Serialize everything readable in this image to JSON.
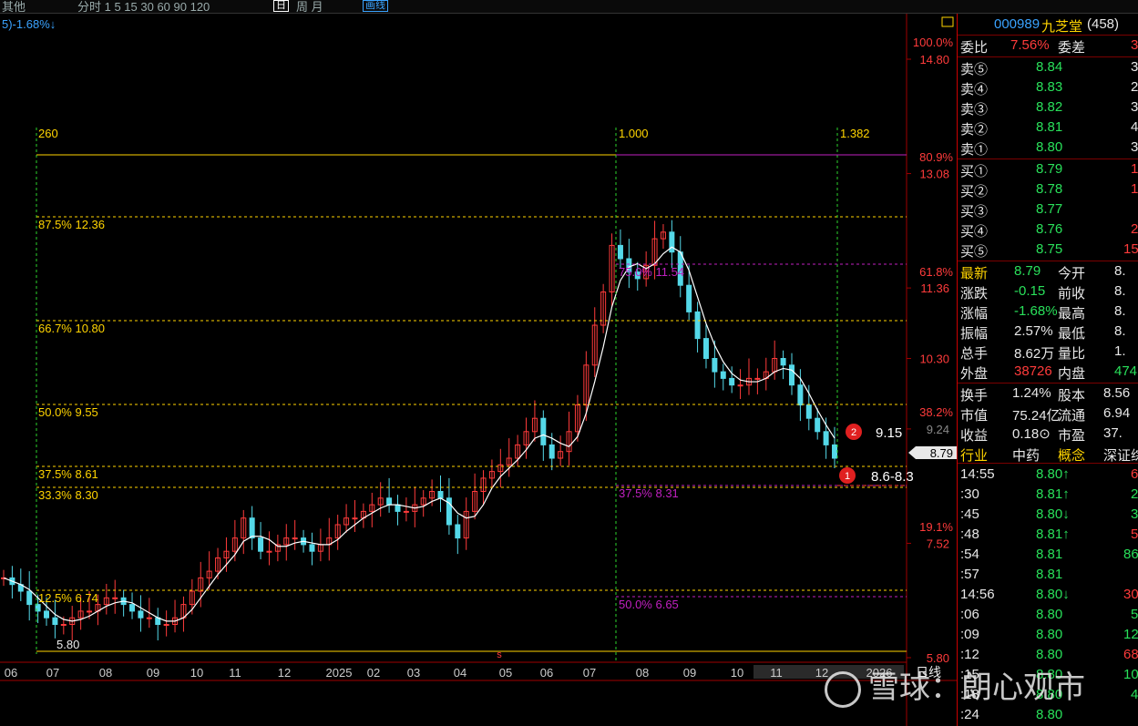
{
  "toolbar": {
    "left_text": "其他",
    "periods": "分时   1   5  15  30  60  90  120",
    "active_period": "日",
    "other_periods": "周  月",
    "button": "画线"
  },
  "chart_header": {
    "label": "5)-1.68%↓"
  },
  "chart_data": {
    "type": "candlestick",
    "title": "",
    "x_labels": [
      "06",
      "07",
      "08",
      "09",
      "10",
      "11",
      "12",
      "2025",
      "02",
      "03",
      "04",
      "05",
      "06",
      "07",
      "08",
      "09",
      "10",
      "11",
      "12",
      "2026"
    ],
    "y_ticks": [
      "14.80",
      "13.08",
      "11.36",
      "10.30",
      "9.24",
      "7.52",
      "5.80"
    ],
    "y_pct_ticks": [
      "100.0%",
      "80.9%",
      "61.8%",
      "38.2%",
      "19.1%"
    ],
    "ylim": [
      5.8,
      14.8
    ],
    "low_point": "5.80",
    "fib_left": {
      "start_label": "260",
      "levels": [
        {
          "label": "87.5% 12.36",
          "price": 12.36
        },
        {
          "label": "66.7% 10.80",
          "price": 10.8
        },
        {
          "label": "50.0% 9.55",
          "price": 9.55
        },
        {
          "label": "37.5% 8.61",
          "price": 8.61
        },
        {
          "label": "33.3% 8.30",
          "price": 8.3
        },
        {
          "label": "12.5% 6.74",
          "price": 6.74
        }
      ]
    },
    "fib_right": {
      "start_label": "1.000",
      "end_label": "1.382",
      "levels": [
        {
          "label": "75.0% 11.54",
          "price": 11.54
        },
        {
          "label": "37.5% 8.31",
          "price": 8.31
        },
        {
          "label": "50.0% 6.65",
          "price": 6.65
        }
      ]
    },
    "annotations": [
      {
        "num": "2",
        "text": "9.15",
        "price": 9.15
      },
      {
        "num": "1",
        "text": "8.6-8.3",
        "price": 8.45
      }
    ],
    "current_price": "8.79",
    "close_series": [
      7.0,
      6.9,
      6.8,
      6.6,
      6.5,
      6.4,
      6.3,
      6.3,
      6.4,
      6.5,
      6.5,
      6.6,
      6.7,
      6.7,
      6.6,
      6.5,
      6.4,
      6.4,
      6.3,
      6.3,
      6.4,
      6.6,
      6.8,
      7.0,
      7.1,
      7.3,
      7.4,
      7.6,
      7.9,
      7.6,
      7.4,
      7.4,
      7.5,
      7.6,
      7.6,
      7.5,
      7.4,
      7.5,
      7.6,
      7.8,
      7.9,
      7.9,
      8.0,
      8.1,
      8.2,
      8.1,
      8.0,
      8.0,
      8.1,
      8.2,
      8.3,
      8.2,
      7.8,
      7.6,
      8.0,
      8.3,
      8.5,
      8.6,
      8.7,
      8.8,
      9.0,
      9.2,
      9.4,
      9.0,
      8.8,
      8.9,
      9.2,
      9.6,
      10.2,
      10.8,
      11.3,
      12.0,
      11.8,
      11.6,
      11.5,
      11.7,
      12.1,
      12.2,
      11.9,
      11.4,
      11.0,
      10.6,
      10.3,
      10.1,
      10.0,
      9.9,
      9.9,
      10.0,
      10.0,
      10.1,
      10.3,
      10.2,
      9.9,
      9.6,
      9.4,
      9.2,
      9.0,
      8.8
    ]
  },
  "side": {
    "code": "000989",
    "name": "九芝堂",
    "count": "(458)",
    "weibi_label": "委比",
    "weibi_value": "7.56%",
    "weicha_label": "委差",
    "weicha_value": "3",
    "asks": [
      {
        "label": "卖⑤",
        "price": "8.84",
        "vol": "3"
      },
      {
        "label": "卖④",
        "price": "8.83",
        "vol": "2"
      },
      {
        "label": "卖③",
        "price": "8.82",
        "vol": "3"
      },
      {
        "label": "卖②",
        "price": "8.81",
        "vol": "4"
      },
      {
        "label": "卖①",
        "price": "8.80",
        "vol": "3"
      }
    ],
    "bids": [
      {
        "label": "买①",
        "price": "8.79",
        "vol": "1"
      },
      {
        "label": "买②",
        "price": "8.78",
        "vol": "1"
      },
      {
        "label": "买③",
        "price": "8.77",
        "vol": ""
      },
      {
        "label": "买④",
        "price": "8.76",
        "vol": "2"
      },
      {
        "label": "买⑤",
        "price": "8.75",
        "vol": "15"
      }
    ],
    "stats": [
      {
        "l1": "最新",
        "v1": "8.79",
        "l2": "今开",
        "v2": "8."
      },
      {
        "l1": "涨跌",
        "v1": "-0.15",
        "l2": "前收",
        "v2": "8."
      },
      {
        "l1": "涨幅",
        "v1": "-1.68%",
        "l2": "最高",
        "v2": "8."
      },
      {
        "l1": "振幅",
        "v1": "2.57%",
        "l2": "最低",
        "v2": "8."
      },
      {
        "l1": "总手",
        "v1": "8.62万",
        "l2": "量比",
        "v2": "1."
      },
      {
        "l1": "外盘",
        "v1": "38726",
        "l2": "内盘",
        "v2": "474"
      }
    ],
    "info": [
      {
        "l1": "换手",
        "v1": "1.24%",
        "l2": "股本",
        "v2": "8.56"
      },
      {
        "l1": "市值",
        "v1": "75.24亿",
        "l2": "流通",
        "v2": "6.94"
      },
      {
        "l1": "收益",
        "v1": "0.18⊙",
        "l2": "市盈",
        "v2": "37."
      },
      {
        "l1": "行业",
        "v1": "中药",
        "l2": "概念",
        "v2": "深证综指"
      }
    ],
    "ticks": [
      {
        "t": "14:55",
        "p": "8.80",
        "a": "↑",
        "v": "6"
      },
      {
        "t": ":30",
        "p": "8.81",
        "a": "↑",
        "v": "2"
      },
      {
        "t": ":45",
        "p": "8.80",
        "a": "↓",
        "v": "3"
      },
      {
        "t": ":48",
        "p": "8.81",
        "a": "↑",
        "v": "5"
      },
      {
        "t": ":54",
        "p": "8.81",
        "a": "",
        "v": "86"
      },
      {
        "t": ":57",
        "p": "8.81",
        "a": "",
        "v": ""
      },
      {
        "t": "14:56",
        "p": "8.80",
        "a": "↓",
        "v": "30"
      },
      {
        "t": ":06",
        "p": "8.80",
        "a": "",
        "v": "5"
      },
      {
        "t": ":09",
        "p": "8.80",
        "a": "",
        "v": "12"
      },
      {
        "t": ":12",
        "p": "8.80",
        "a": "",
        "v": "68"
      },
      {
        "t": ":15",
        "p": "8.80",
        "a": "",
        "v": "10"
      },
      {
        "t": ":18",
        "p": "8.80",
        "a": "",
        "v": "4"
      },
      {
        "t": ":24",
        "p": "8.80",
        "a": "",
        "v": ""
      }
    ]
  },
  "bottom": {
    "period_label": "日线"
  },
  "watermark": "雪球：朗心观市"
}
